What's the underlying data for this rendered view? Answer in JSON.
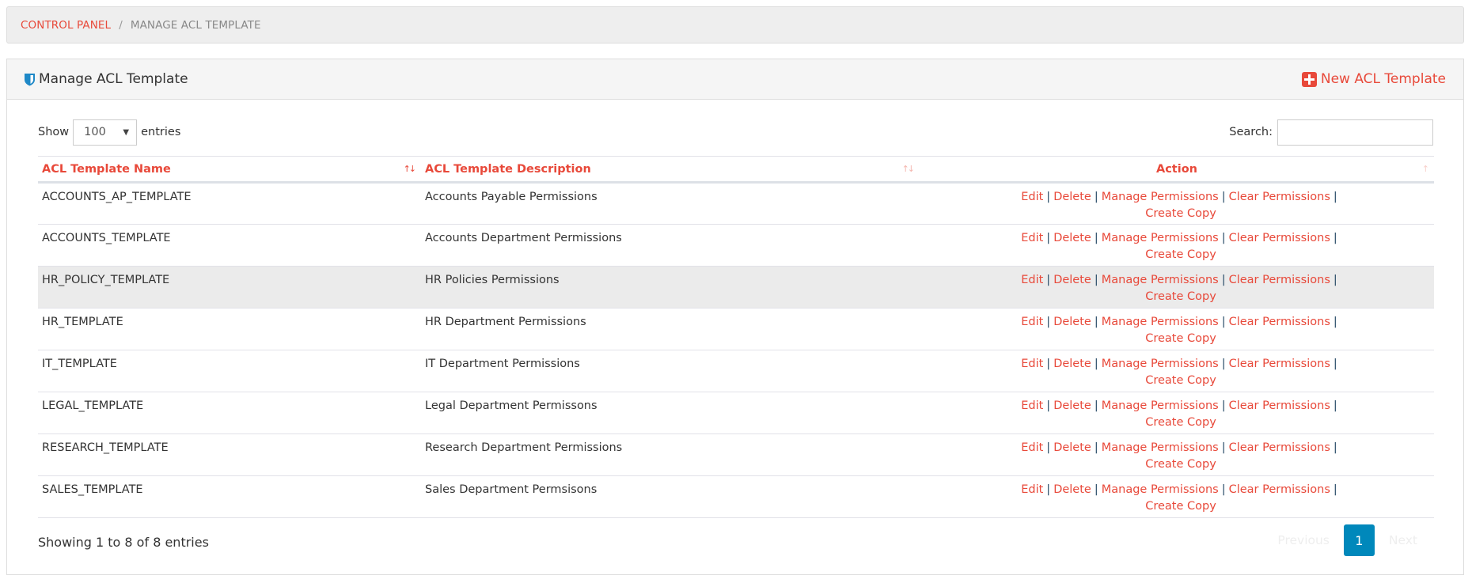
{
  "breadcrumb": {
    "root": "CONTROL PANEL",
    "separator": "/",
    "current": "MANAGE ACL TEMPLATE"
  },
  "panel": {
    "title": "Manage ACL Template",
    "title_icon": "shield-icon",
    "new_button": "New ACL Template",
    "new_button_icon": "plus-square-icon"
  },
  "controls": {
    "show_label": "Show",
    "entries_label": "entries",
    "page_length": "100",
    "search_label": "Search:",
    "search_value": ""
  },
  "table": {
    "columns": [
      {
        "label": "ACL Template Name",
        "sort": "asc"
      },
      {
        "label": "ACL Template Description",
        "sort": "none"
      },
      {
        "label": "Action",
        "sort": "none"
      }
    ],
    "action_labels": {
      "edit": "Edit",
      "delete": "Delete",
      "manage": "Manage Permissions",
      "clear": "Clear Permissions",
      "copy": "Create Copy",
      "separator": "|"
    },
    "rows": [
      {
        "name": "ACCOUNTS_AP_TEMPLATE",
        "description": "Accounts Payable Permissions"
      },
      {
        "name": "ACCOUNTS_TEMPLATE",
        "description": "Accounts Department Permissions"
      },
      {
        "name": "HR_POLICY_TEMPLATE",
        "description": "HR Policies Permissions"
      },
      {
        "name": "HR_TEMPLATE",
        "description": "HR Department Permissions"
      },
      {
        "name": "IT_TEMPLATE",
        "description": "IT Department Permissions"
      },
      {
        "name": "LEGAL_TEMPLATE",
        "description": "Legal Department Permissons"
      },
      {
        "name": "RESEARCH_TEMPLATE",
        "description": "Research Department Permissions"
      },
      {
        "name": "SALES_TEMPLATE",
        "description": "Sales Department Permsisons"
      }
    ],
    "hovered_row": 2
  },
  "footer": {
    "info": "Showing 1 to 8 of 8 entries",
    "previous": "Previous",
    "current_page": "1",
    "next": "Next"
  },
  "colors": {
    "accent": "#e8493a",
    "pagination_active": "#0088bb",
    "shield": "#1e88c7"
  }
}
